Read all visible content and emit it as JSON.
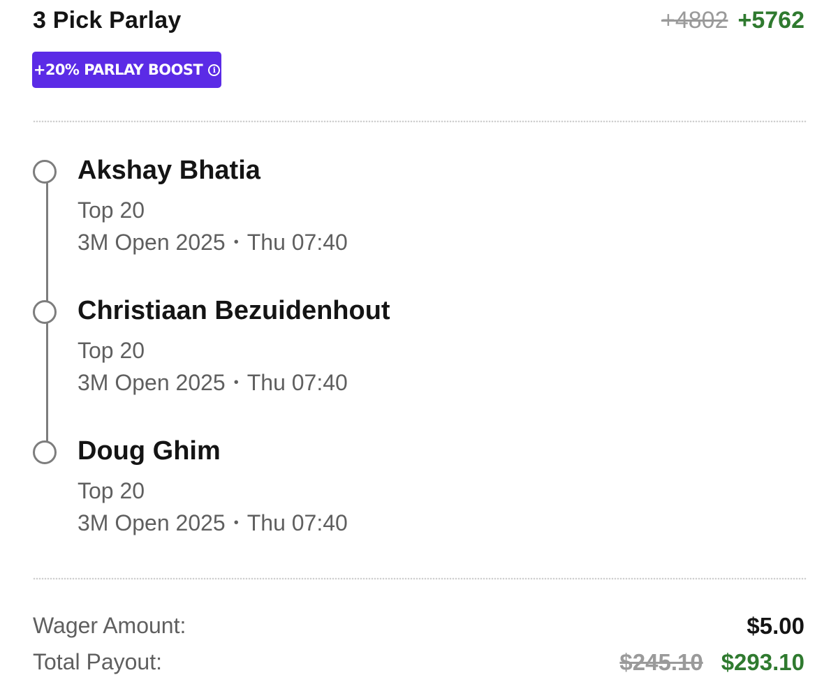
{
  "header": {
    "title": "3 Pick Parlay",
    "old_odds": "+4802",
    "new_odds": "+5762"
  },
  "boost": {
    "label": "+20% PARLAY BOOST",
    "info_icon": "info-icon"
  },
  "legs": [
    {
      "player": "Akshay Bhatia",
      "market": "Top 20",
      "event": "3M Open 2025",
      "separator": "•",
      "time": "Thu 07:40"
    },
    {
      "player": "Christiaan Bezuidenhout",
      "market": "Top 20",
      "event": "3M Open 2025",
      "separator": "•",
      "time": "Thu 07:40"
    },
    {
      "player": "Doug Ghim",
      "market": "Top 20",
      "event": "3M Open 2025",
      "separator": "•",
      "time": "Thu 07:40"
    }
  ],
  "summary": {
    "wager_label": "Wager Amount:",
    "wager_value": "$5.00",
    "payout_label": "Total Payout:",
    "old_payout": "$245.10",
    "new_payout": "$293.10"
  },
  "colors": {
    "boost_bg": "#5b2be6",
    "positive_green": "#2f7a2f",
    "strike_gray": "#9a9a9a"
  }
}
